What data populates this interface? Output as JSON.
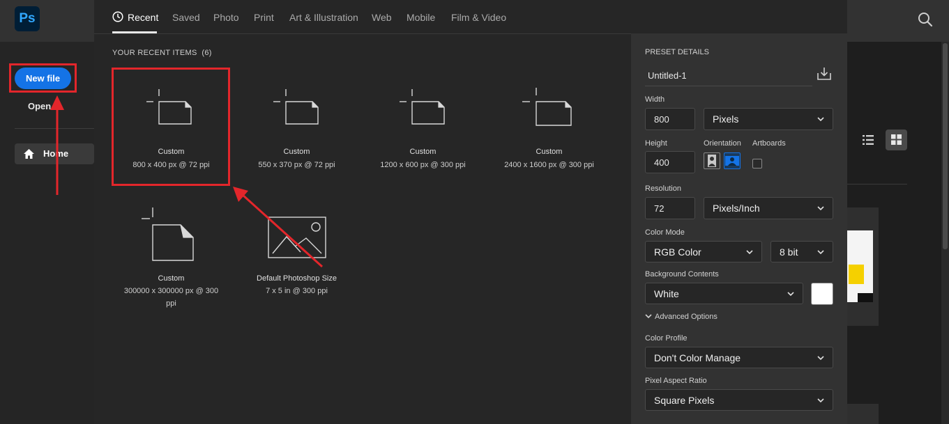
{
  "app": {
    "logo_text": "Ps"
  },
  "left_nav": {
    "new_file_label": "New file",
    "open_label": "Open",
    "home_label": "Home"
  },
  "dialog": {
    "tabs": [
      {
        "label": "Recent"
      },
      {
        "label": "Saved"
      },
      {
        "label": "Photo"
      },
      {
        "label": "Print"
      },
      {
        "label": "Art & Illustration"
      },
      {
        "label": "Web"
      },
      {
        "label": "Mobile"
      },
      {
        "label": "Film & Video"
      }
    ],
    "active_tab": "Recent",
    "recent_title": "YOUR RECENT ITEMS",
    "recent_count": "(6)",
    "presets": [
      {
        "name": "Custom",
        "size": "800 x 400 px @ 72 ppi",
        "icon": "document-icon"
      },
      {
        "name": "Custom",
        "size": "550 x 370 px @ 72 ppi",
        "icon": "document-icon"
      },
      {
        "name": "Custom",
        "size": "1200 x 600 px @ 300 ppi",
        "icon": "document-icon"
      },
      {
        "name": "Custom",
        "size": "2400 x 1600 px @ 300 ppi",
        "icon": "document-icon"
      },
      {
        "name": "Custom",
        "size_line1": "300000 x 300000 px @ 300",
        "size_line2": "ppi",
        "icon": "document-icon"
      },
      {
        "name": "Default Photoshop Size",
        "size": "7 x 5 in @ 300 ppi",
        "icon": "image-icon"
      }
    ],
    "details": {
      "header": "PRESET DETAILS",
      "title_value": "Untitled-1",
      "width_label": "Width",
      "width_value": "800",
      "width_unit": "Pixels",
      "height_label": "Height",
      "height_value": "400",
      "orientation_label": "Orientation",
      "orientation_selected": "landscape",
      "artboards_label": "Artboards",
      "artboards_checked": false,
      "resolution_label": "Resolution",
      "resolution_value": "72",
      "resolution_unit": "Pixels/Inch",
      "color_mode_label": "Color Mode",
      "color_mode_value": "RGB Color",
      "bit_depth_value": "8 bit",
      "background_label": "Background Contents",
      "background_value": "White",
      "background_swatch": "#ffffff",
      "advanced_label": "Advanced Options",
      "color_profile_label": "Color Profile",
      "color_profile_value": "Don't Color Manage",
      "pixel_aspect_label": "Pixel Aspect Ratio",
      "pixel_aspect_value": "Square Pixels"
    }
  },
  "colors": {
    "accent": "#1473e6",
    "annotation": "#e3262b"
  }
}
